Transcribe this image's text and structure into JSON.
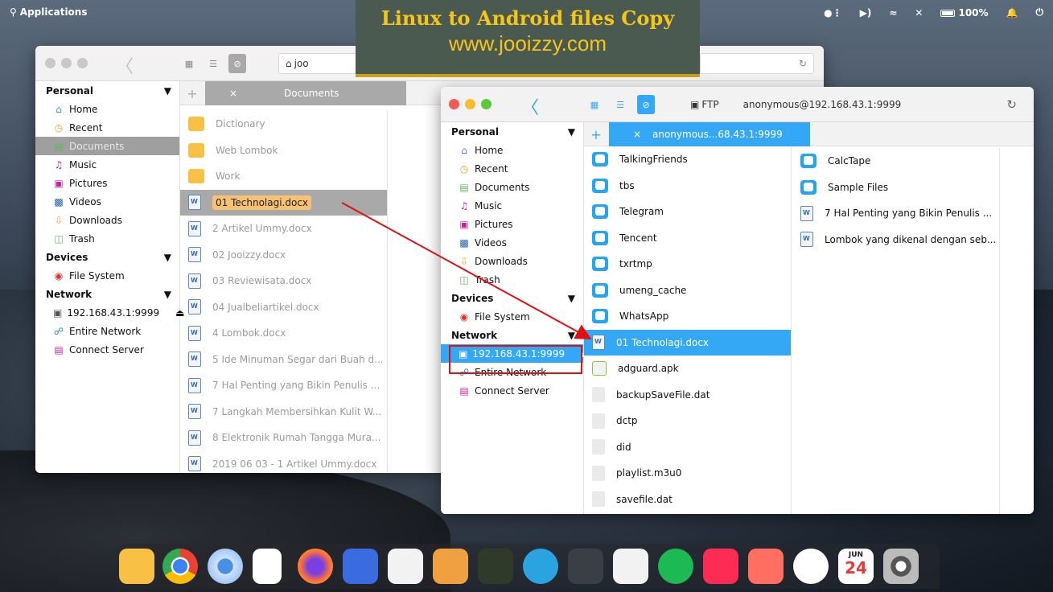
{
  "topbar": {
    "applications_label": "Applications",
    "battery_percent": "100%"
  },
  "banner": {
    "title": "Linux to Android files Copy",
    "subtitle": "www.jooizzy.com"
  },
  "left_window": {
    "address": "joo",
    "tab_label": "Documents",
    "tab_close": "×",
    "plus": "+",
    "sidebar": {
      "personal_header": "Personal",
      "personal_items": [
        "Home",
        "Recent",
        "Documents",
        "Music",
        "Pictures",
        "Videos",
        "Downloads",
        "Trash"
      ],
      "devices_header": "Devices",
      "devices_items": [
        "File System"
      ],
      "network_header": "Network",
      "network_items": [
        "192.168.43.1:9999",
        "Entire Network",
        "Connect Server"
      ]
    },
    "files": [
      {
        "name": "Dictionary",
        "type": "folder"
      },
      {
        "name": "Web Lombok",
        "type": "folder"
      },
      {
        "name": "Work",
        "type": "folder"
      },
      {
        "name": "01 Technolagi.docx",
        "type": "doc",
        "selected": true
      },
      {
        "name": "2 Artikel Ummy.docx",
        "type": "doc"
      },
      {
        "name": "02 Jooizzy.docx",
        "type": "doc"
      },
      {
        "name": "03 Reviewisata.docx",
        "type": "doc"
      },
      {
        "name": "04 Jualbeliartikel.docx",
        "type": "doc"
      },
      {
        "name": "4 Lombok.docx",
        "type": "doc"
      },
      {
        "name": "5 Ide Minuman Segar dari Buah d...",
        "type": "doc"
      },
      {
        "name": "7 Hal Penting yang Bikin Penulis ...",
        "type": "doc"
      },
      {
        "name": "7 Langkah Membersihkan Kulit W...",
        "type": "doc"
      },
      {
        "name": "8 Elektronik Rumah Tangga Mura...",
        "type": "doc"
      },
      {
        "name": "2019 06 03 - 1 Artikel Ummy.docx",
        "type": "doc"
      }
    ]
  },
  "right_window": {
    "address_protocol": "FTP",
    "address_value": "anonymous@192.168.43.1:9999",
    "tab_label": "anonymous...68.43.1:9999",
    "tab_close": "×",
    "plus": "+",
    "sidebar": {
      "personal_header": "Personal",
      "personal_items": [
        "Home",
        "Recent",
        "Documents",
        "Music",
        "Pictures",
        "Videos",
        "Downloads",
        "Trash"
      ],
      "devices_header": "Devices",
      "devices_items": [
        "File System"
      ],
      "network_header": "Network",
      "network_items": [
        "192.168.43.1:9999",
        "Entire Network",
        "Connect Server"
      ]
    },
    "col1": [
      {
        "name": "TalkingFriends",
        "type": "folder"
      },
      {
        "name": "tbs",
        "type": "folder"
      },
      {
        "name": "Telegram",
        "type": "folder"
      },
      {
        "name": "Tencent",
        "type": "folder"
      },
      {
        "name": "txrtmp",
        "type": "folder"
      },
      {
        "name": "umeng_cache",
        "type": "folder"
      },
      {
        "name": "WhatsApp",
        "type": "folder"
      },
      {
        "name": "01 Technolagi.docx",
        "type": "doc",
        "selected": true
      },
      {
        "name": "adguard.apk",
        "type": "apk"
      },
      {
        "name": "backupSaveFile.dat",
        "type": "file"
      },
      {
        "name": "dctp",
        "type": "file"
      },
      {
        "name": "did",
        "type": "file"
      },
      {
        "name": "playlist.m3u0",
        "type": "file"
      },
      {
        "name": "savefile.dat",
        "type": "file"
      }
    ],
    "col2": [
      {
        "name": "CalcTape",
        "type": "folder"
      },
      {
        "name": "Sample Files",
        "type": "folder"
      },
      {
        "name": "7 Hal Penting yang Bikin Penulis ...",
        "type": "doc"
      },
      {
        "name": "Lombok yang dikenal dengan seb...",
        "type": "doc"
      }
    ]
  },
  "dock": {
    "calendar_month": "JUN",
    "calendar_day": "24"
  },
  "colors": {
    "accent_blue": "#34a8f4",
    "selection_gray": "#9f9f9f",
    "annotation_red": "#e01010",
    "banner_gold": "#f5c518"
  }
}
